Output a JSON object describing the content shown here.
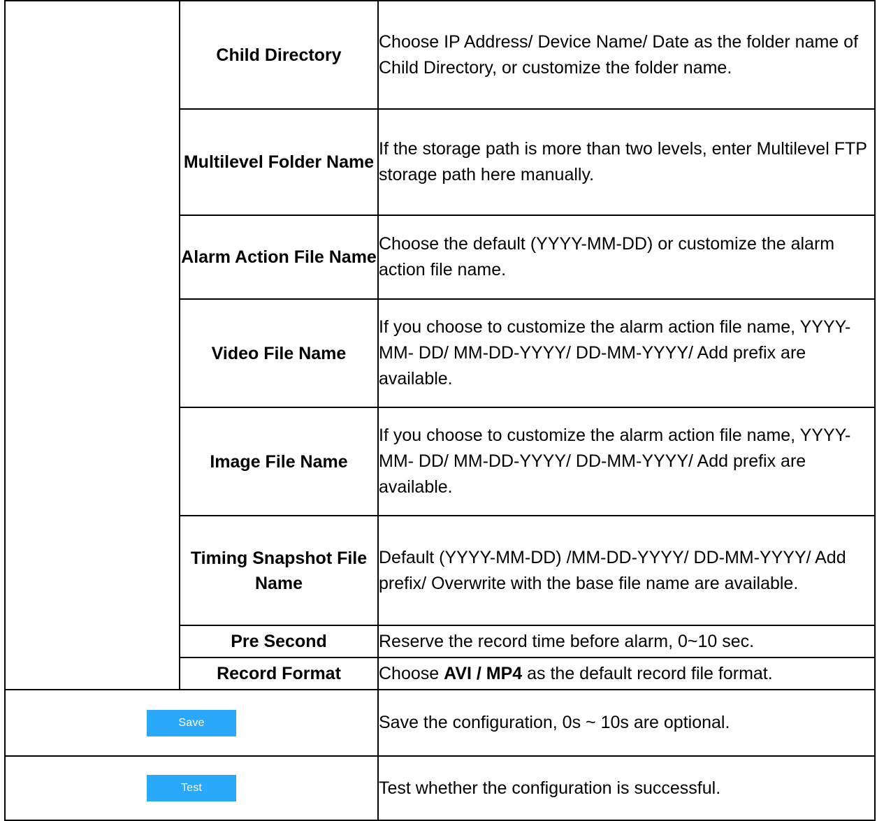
{
  "rows": [
    {
      "name": "Child Directory",
      "desc": "Choose IP Address/ Device Name/ Date as the folder name of Child Directory, or customize the folder name."
    },
    {
      "name": "Multilevel Folder Name",
      "desc": "If the storage path is more than two levels, enter Multilevel FTP storage path here manually."
    },
    {
      "name": "Alarm Action File Name",
      "desc": "Choose the default (YYYY-MM-DD) or customize the alarm action file name."
    },
    {
      "name": "Video File Name",
      "desc": "If you choose to customize the alarm action file name, YYYY-MM- DD/ MM-DD-YYYY/ DD-MM-YYYY/ Add prefix are available."
    },
    {
      "name": "Image File Name",
      "desc": "If you choose to customize the alarm action file name, YYYY-MM- DD/ MM-DD-YYYY/ DD-MM-YYYY/ Add prefix are available."
    },
    {
      "name": "Timing Snapshot File Name",
      "desc": "Default (YYYY-MM-DD) /MM-DD-YYYY/ DD-MM-YYYY/ Add prefix/ Overwrite with the base file name are available."
    },
    {
      "name": "Pre Second",
      "desc": "Reserve the record time before alarm, 0~10 sec."
    },
    {
      "name": "Record Format",
      "desc_prefix": "Choose ",
      "desc_bold": "AVI / MP4",
      "desc_suffix": " as the default record file format."
    }
  ],
  "save": {
    "label": "Save",
    "desc": "Save the configuration, 0s ~ 10s are optional."
  },
  "test": {
    "label": "Test",
    "desc": "Test whether the configuration is successful."
  },
  "colors": {
    "button_bg": "#2aa9fb",
    "button_text": "#ffffff",
    "border": "#000000"
  }
}
